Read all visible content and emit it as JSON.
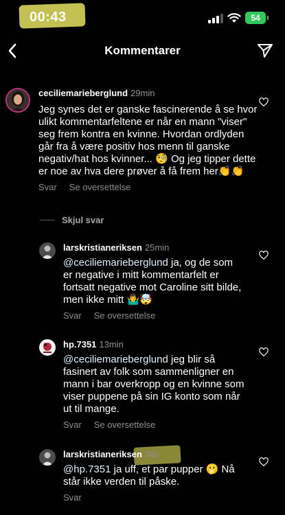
{
  "status": {
    "time": "00:43",
    "battery": "54"
  },
  "nav": {
    "title": "Kommentarer"
  },
  "comments": [
    {
      "username": "ceciliemarieberglund",
      "time": "29min",
      "text": "Jeg synes det er ganske fascinerende å se hvor ulikt kommentarfeltene er når en mann \"viser\" seg frem kontra en kvinne. Hvordan ordlyden går fra å være positiv hos menn til ganske negativ/hat hos kvinner... 🧐 Og jeg tipper dette er noe av hva dere prøver å få frem her👏👏",
      "reply": "Svar",
      "translate": "Se oversettelse"
    }
  ],
  "hide_replies": "Skjul svar",
  "replies": [
    {
      "username": "larskristianeriksen",
      "time": "25min",
      "mention": "@ceciliemarieberglund",
      "text": " ja, og de som er negative i mitt kommentarfelt er fortsatt negative mot Caroline sitt bilde, men ikke mitt 🤷‍♂️🤯",
      "reply": "Svar",
      "translate": "Se oversettelse"
    },
    {
      "username": "hp.7351",
      "time": "13min",
      "mention": "@ceciliemarieberglund",
      "text": " jeg blir så fasinert av folk som sammenligner en mann i bar overkropp og en kvinne som viser puppene på sin IG konto som når ut til mange.",
      "reply": "Svar",
      "translate": "Se oversettelse"
    },
    {
      "username": "larskristianeriksen",
      "time": "36s",
      "mention": "@hp.7351",
      "text": " ja uff, et par pupper 🫢 Nå står ikke verden til påske.",
      "reply": "Svar"
    }
  ],
  "colors": {
    "background": "#000000",
    "text": "#ffffff",
    "muted": "#8e8e8e",
    "mention": "#e0f1ff",
    "battery": "#34c759"
  }
}
